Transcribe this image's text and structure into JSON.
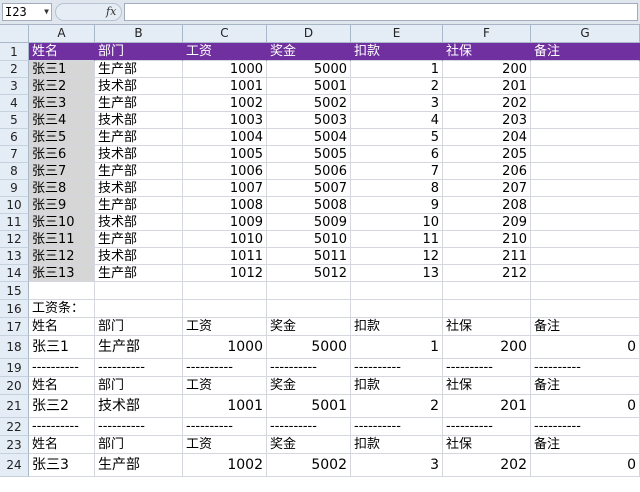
{
  "name_box": "I23",
  "fx_label": "fx",
  "columns": [
    "A",
    "B",
    "C",
    "D",
    "E",
    "F",
    "G"
  ],
  "rows": [
    [
      "姓名",
      "部门",
      "工资",
      "奖金",
      "扣款",
      "社保",
      "备注"
    ],
    [
      "张三1",
      "生产部",
      "1000",
      "5000",
      "1",
      "200",
      ""
    ],
    [
      "张三2",
      "技术部",
      "1001",
      "5001",
      "2",
      "201",
      ""
    ],
    [
      "张三3",
      "生产部",
      "1002",
      "5002",
      "3",
      "202",
      ""
    ],
    [
      "张三4",
      "技术部",
      "1003",
      "5003",
      "4",
      "203",
      ""
    ],
    [
      "张三5",
      "生产部",
      "1004",
      "5004",
      "5",
      "204",
      ""
    ],
    [
      "张三6",
      "技术部",
      "1005",
      "5005",
      "6",
      "205",
      ""
    ],
    [
      "张三7",
      "生产部",
      "1006",
      "5006",
      "7",
      "206",
      ""
    ],
    [
      "张三8",
      "技术部",
      "1007",
      "5007",
      "8",
      "207",
      ""
    ],
    [
      "张三9",
      "生产部",
      "1008",
      "5008",
      "9",
      "208",
      ""
    ],
    [
      "张三10",
      "技术部",
      "1009",
      "5009",
      "10",
      "209",
      ""
    ],
    [
      "张三11",
      "生产部",
      "1010",
      "5010",
      "11",
      "210",
      ""
    ],
    [
      "张三12",
      "技术部",
      "1011",
      "5011",
      "12",
      "211",
      ""
    ],
    [
      "张三13",
      "生产部",
      "1012",
      "5012",
      "13",
      "212",
      ""
    ],
    [
      "",
      "",
      "",
      "",
      "",
      "",
      ""
    ],
    [
      "工资条：",
      "",
      "",
      "",
      "",
      "",
      ""
    ],
    [
      "姓名",
      "部门",
      "工资",
      "奖金",
      "扣款",
      "社保",
      "备注"
    ],
    [
      "张三1",
      "生产部",
      "1000",
      "5000",
      "1",
      "200",
      "0"
    ],
    [
      "----------",
      "----------",
      "----------",
      "----------",
      "----------",
      "----------",
      "----------"
    ],
    [
      "姓名",
      "部门",
      "工资",
      "奖金",
      "扣款",
      "社保",
      "备注"
    ],
    [
      "张三2",
      "技术部",
      "1001",
      "5001",
      "2",
      "201",
      "0"
    ],
    [
      "----------",
      "----------",
      "----------",
      "----------",
      "----------",
      "----------",
      "----------"
    ],
    [
      "姓名",
      "部门",
      "工资",
      "奖金",
      "扣款",
      "社保",
      "备注"
    ],
    [
      "张三3",
      "生产部",
      "1002",
      "5002",
      "3",
      "202",
      "0"
    ]
  ],
  "colors": {
    "header_fill": "#7030a0",
    "selection_fill": "#d6d6d6"
  }
}
